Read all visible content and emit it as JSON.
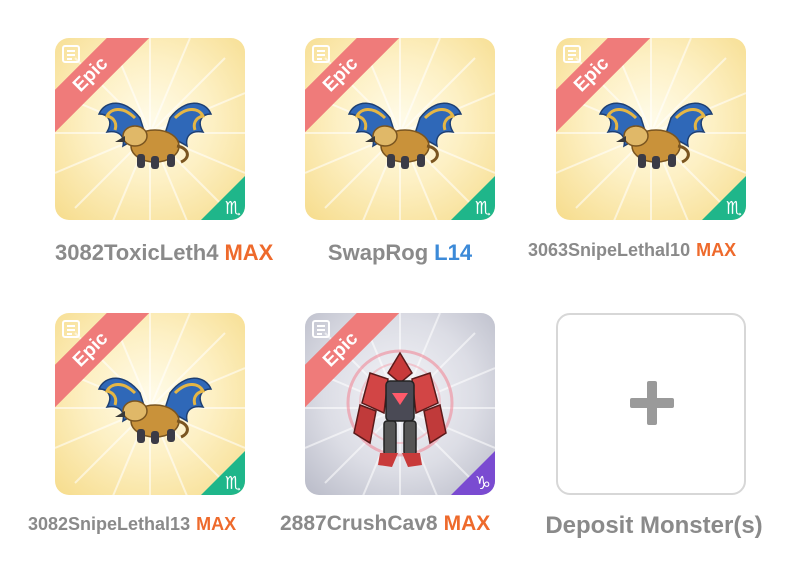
{
  "colors": {
    "max": "#ee6a2c",
    "level": "#3c8ad8",
    "name": "#8a8a8a",
    "epic_ribbon": "#ef7b7a",
    "nature_badge": "#1fb68a",
    "purple_badge": "#7a4bd1"
  },
  "slots": [
    {
      "name": "3082ToxicLeth4",
      "level": "MAX",
      "rarity": "Epic",
      "element": "nature-icon",
      "monster": "griffin-monster"
    },
    {
      "name": "SwapRog",
      "level": "L14",
      "rarity": "Epic",
      "element": "nature-icon",
      "monster": "griffin-monster"
    },
    {
      "name": "3063SnipeLethal10",
      "level": "MAX",
      "rarity": "Epic",
      "element": "nature-icon",
      "monster": "griffin-monster"
    },
    {
      "name": "3082SnipeLethal13",
      "level": "MAX",
      "rarity": "Epic",
      "element": "nature-icon",
      "monster": "griffin-monster"
    },
    {
      "name": "2887CrushCav8",
      "level": "MAX",
      "rarity": "Epic",
      "element": "metal-icon",
      "monster": "crystal-golem-monster"
    }
  ],
  "deposit": {
    "label": "Deposit Monster(s)"
  }
}
